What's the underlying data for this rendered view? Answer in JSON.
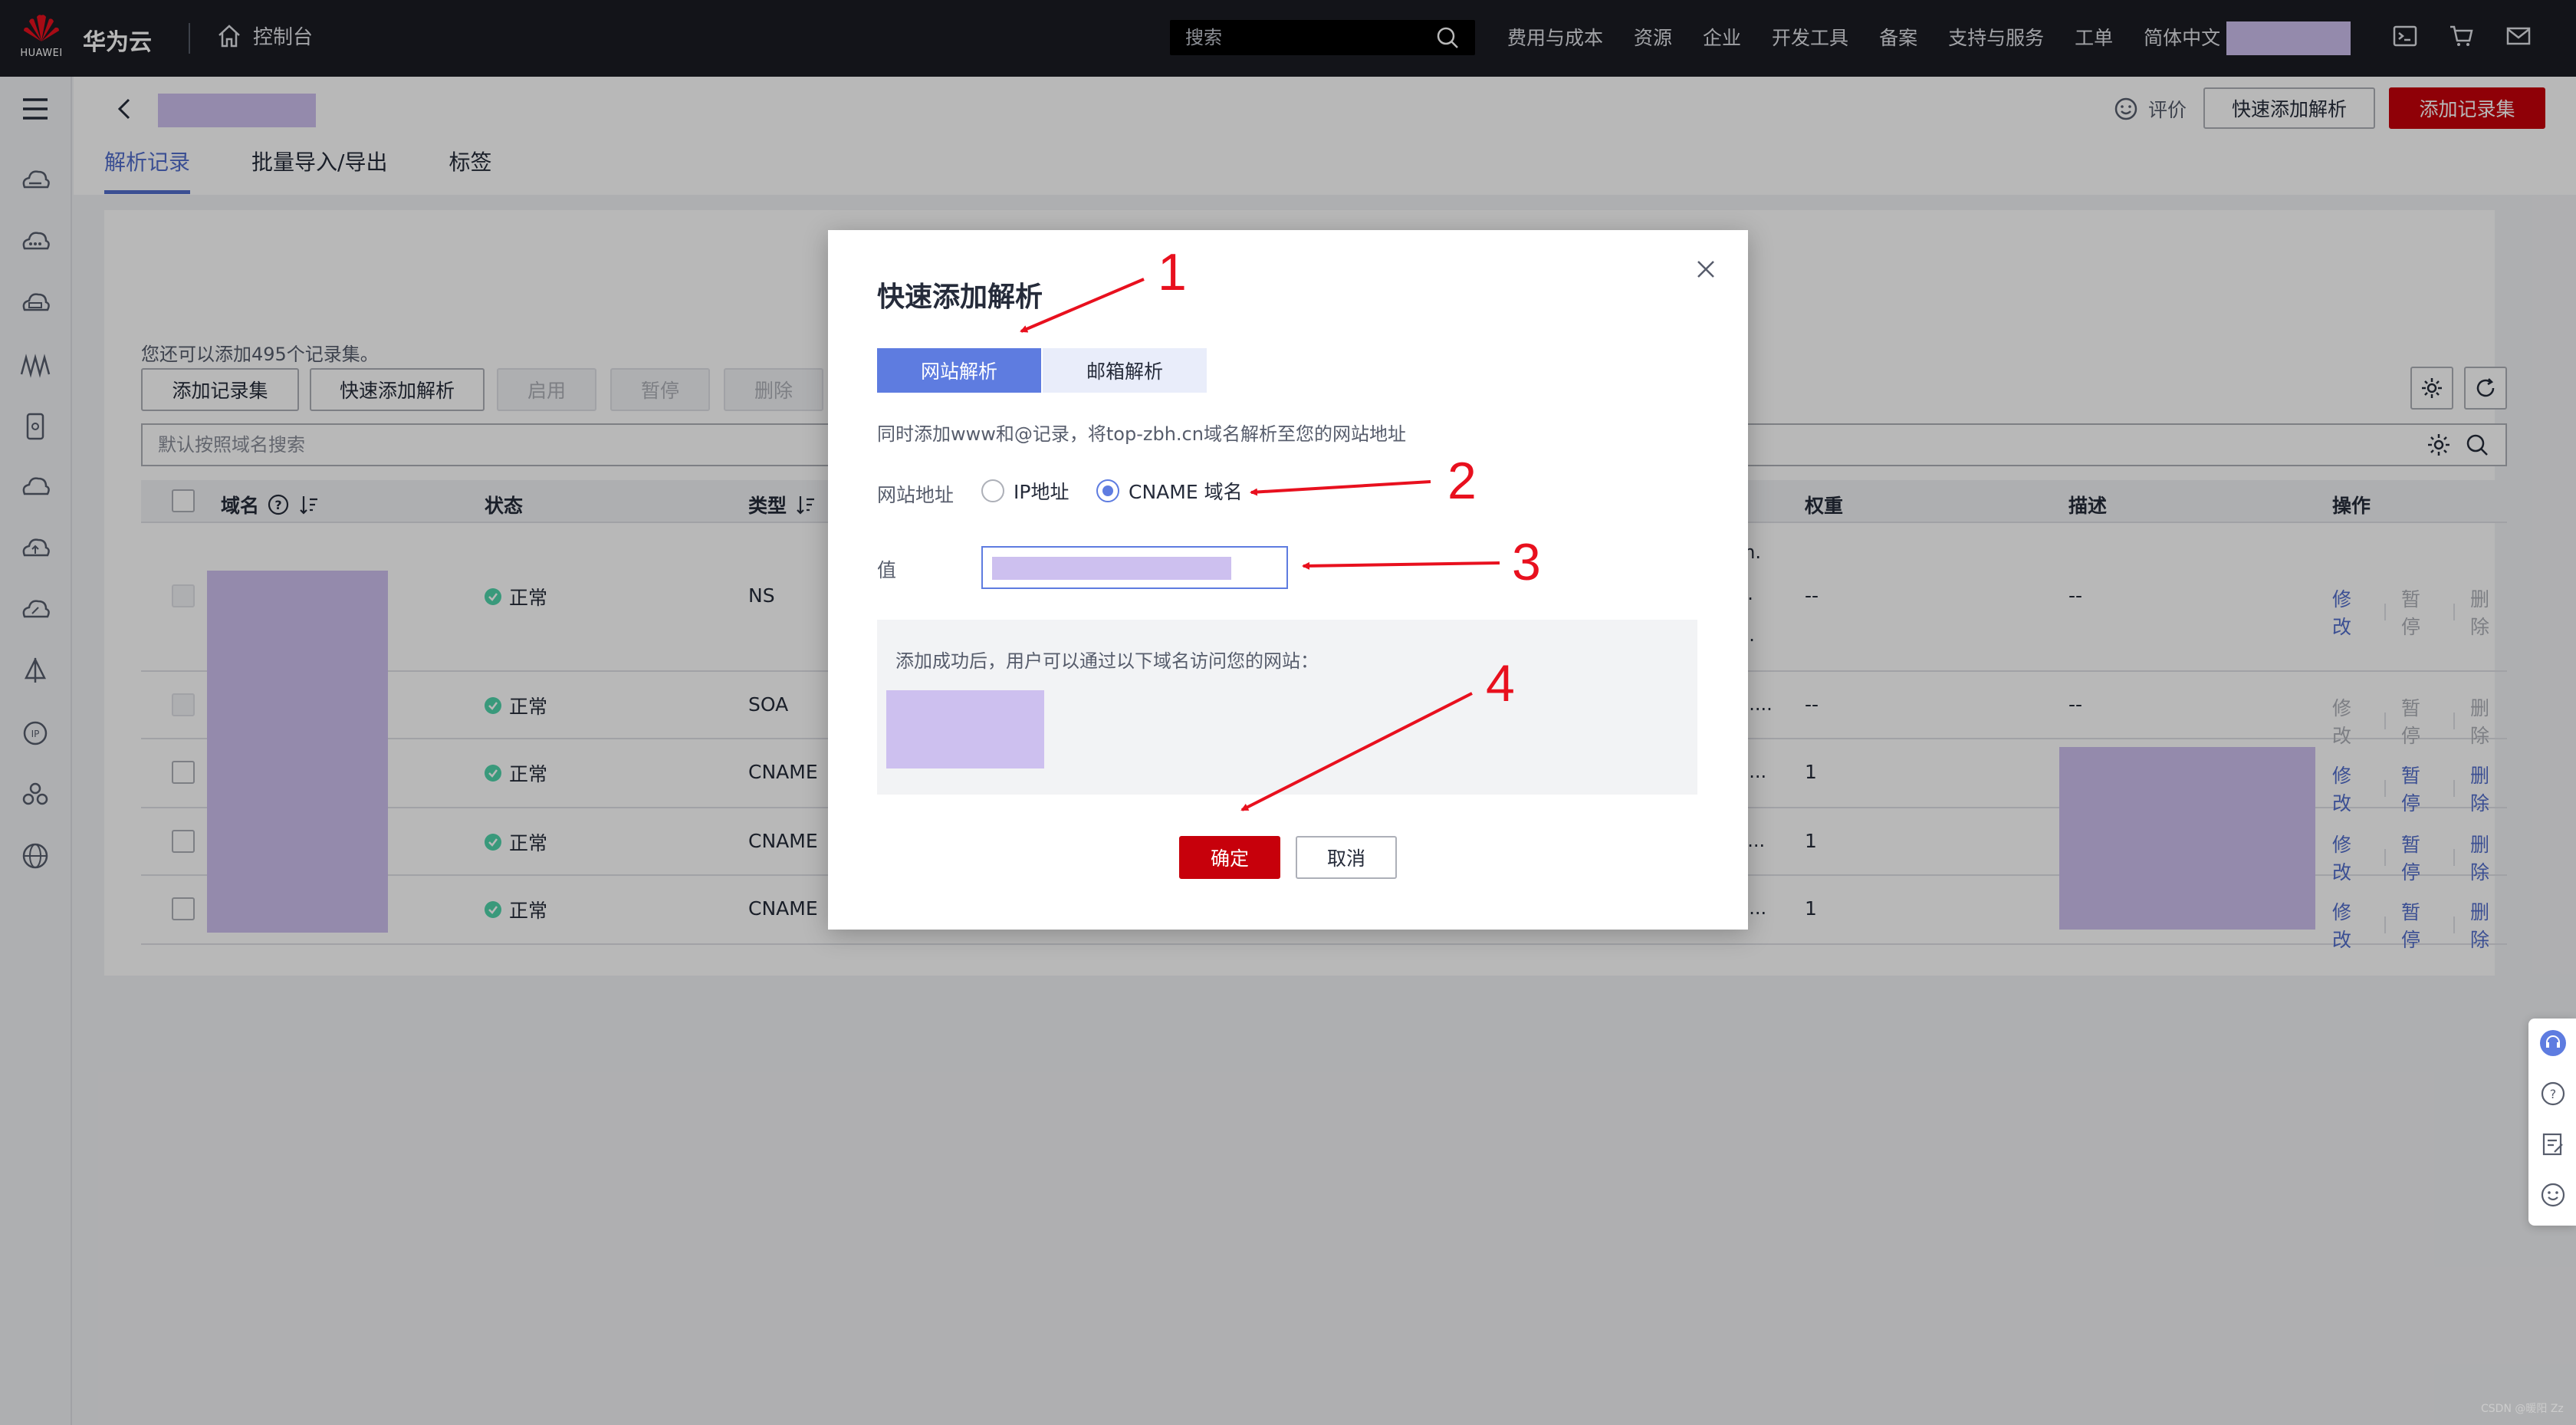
{
  "topnav": {
    "logo_text": "HUAWEI",
    "brand": "华为云",
    "console": "控制台",
    "search_placeholder": "搜索",
    "links": [
      "费用与成本",
      "资源",
      "企业",
      "开发工具",
      "备案",
      "支持与服务",
      "工单",
      "简体中文"
    ],
    "icons": [
      "terminal-icon",
      "cart-icon",
      "mail-icon"
    ]
  },
  "header": {
    "rate_label": "评价",
    "quick_add_label": "快速添加解析",
    "add_record_label": "添加记录集",
    "tabs": [
      {
        "label": "解析记录",
        "active": true
      },
      {
        "label": "批量导入/导出",
        "active": false
      },
      {
        "label": "标签",
        "active": false
      }
    ]
  },
  "list": {
    "hint": "您还可以添加495个记录集。",
    "toolbar": {
      "add": "添加记录集",
      "quick_add": "快速添加解析",
      "enable": "启用",
      "pause": "暂停",
      "delete": "删除"
    },
    "filter_placeholder": "默认按照域名搜索",
    "columns": {
      "domain": "域名",
      "status": "状态",
      "type": "类型",
      "weight": "权重",
      "desc": "描述",
      "ops": "操作"
    },
    "rows": [
      {
        "status": "正常",
        "type": "NS",
        "value_tail": [
          "m.",
          "c.",
          "g."
        ],
        "weight": "--",
        "desc": "--",
        "ops": [
          "修改",
          "暂停",
          "删除"
        ],
        "ops_enabled": [
          true,
          false,
          false
        ]
      },
      {
        "status": "正常",
        "type": "SOA",
        "value_tail": [
          "g...."
        ],
        "weight": "--",
        "desc": "--",
        "ops": [
          "修改",
          "暂停",
          "删除"
        ],
        "ops_enabled": [
          false,
          false,
          false
        ]
      },
      {
        "status": "正常",
        "type": "CNAME",
        "value_tail": [
          "n..."
        ],
        "weight": "1",
        "desc": "",
        "ops": [
          "修改",
          "暂停",
          "删除"
        ],
        "ops_enabled": [
          true,
          true,
          true
        ]
      },
      {
        "status": "正常",
        "type": "CNAME",
        "value_tail": [
          "c..."
        ],
        "weight": "1",
        "desc": "",
        "ops": [
          "修改",
          "暂停",
          "删除"
        ],
        "ops_enabled": [
          true,
          true,
          true
        ]
      },
      {
        "status": "正常",
        "type": "CNAME",
        "value_tail": [
          "n..."
        ],
        "weight": "1",
        "desc": "",
        "ops": [
          "修改",
          "暂停",
          "删除"
        ],
        "ops_enabled": [
          true,
          true,
          true
        ]
      }
    ]
  },
  "modal": {
    "title": "快速添加解析",
    "seg_web": "网站解析",
    "seg_mail": "邮箱解析",
    "desc": "同时添加www和@记录，将top-zbh.cn域名解析至您的网站地址",
    "site_label": "网站地址",
    "opt_ip": "IP地址",
    "opt_cname": "CNAME 域名",
    "selected": "CNAME 域名",
    "value_label": "值",
    "result_text": "添加成功后，用户可以通过以下域名访问您的网站：",
    "ok": "确定",
    "cancel": "取消"
  },
  "annotations": [
    "1",
    "2",
    "3",
    "4"
  ],
  "watermark": "CSDN @暖阳 Zz",
  "colors": {
    "brand_red": "#c7000b",
    "accent_blue": "#5e7ce0",
    "link_blue": "#526ecc",
    "status_green": "#50d4ab",
    "arrow_red": "#e8101e",
    "redaction": "#cdc0ef"
  }
}
